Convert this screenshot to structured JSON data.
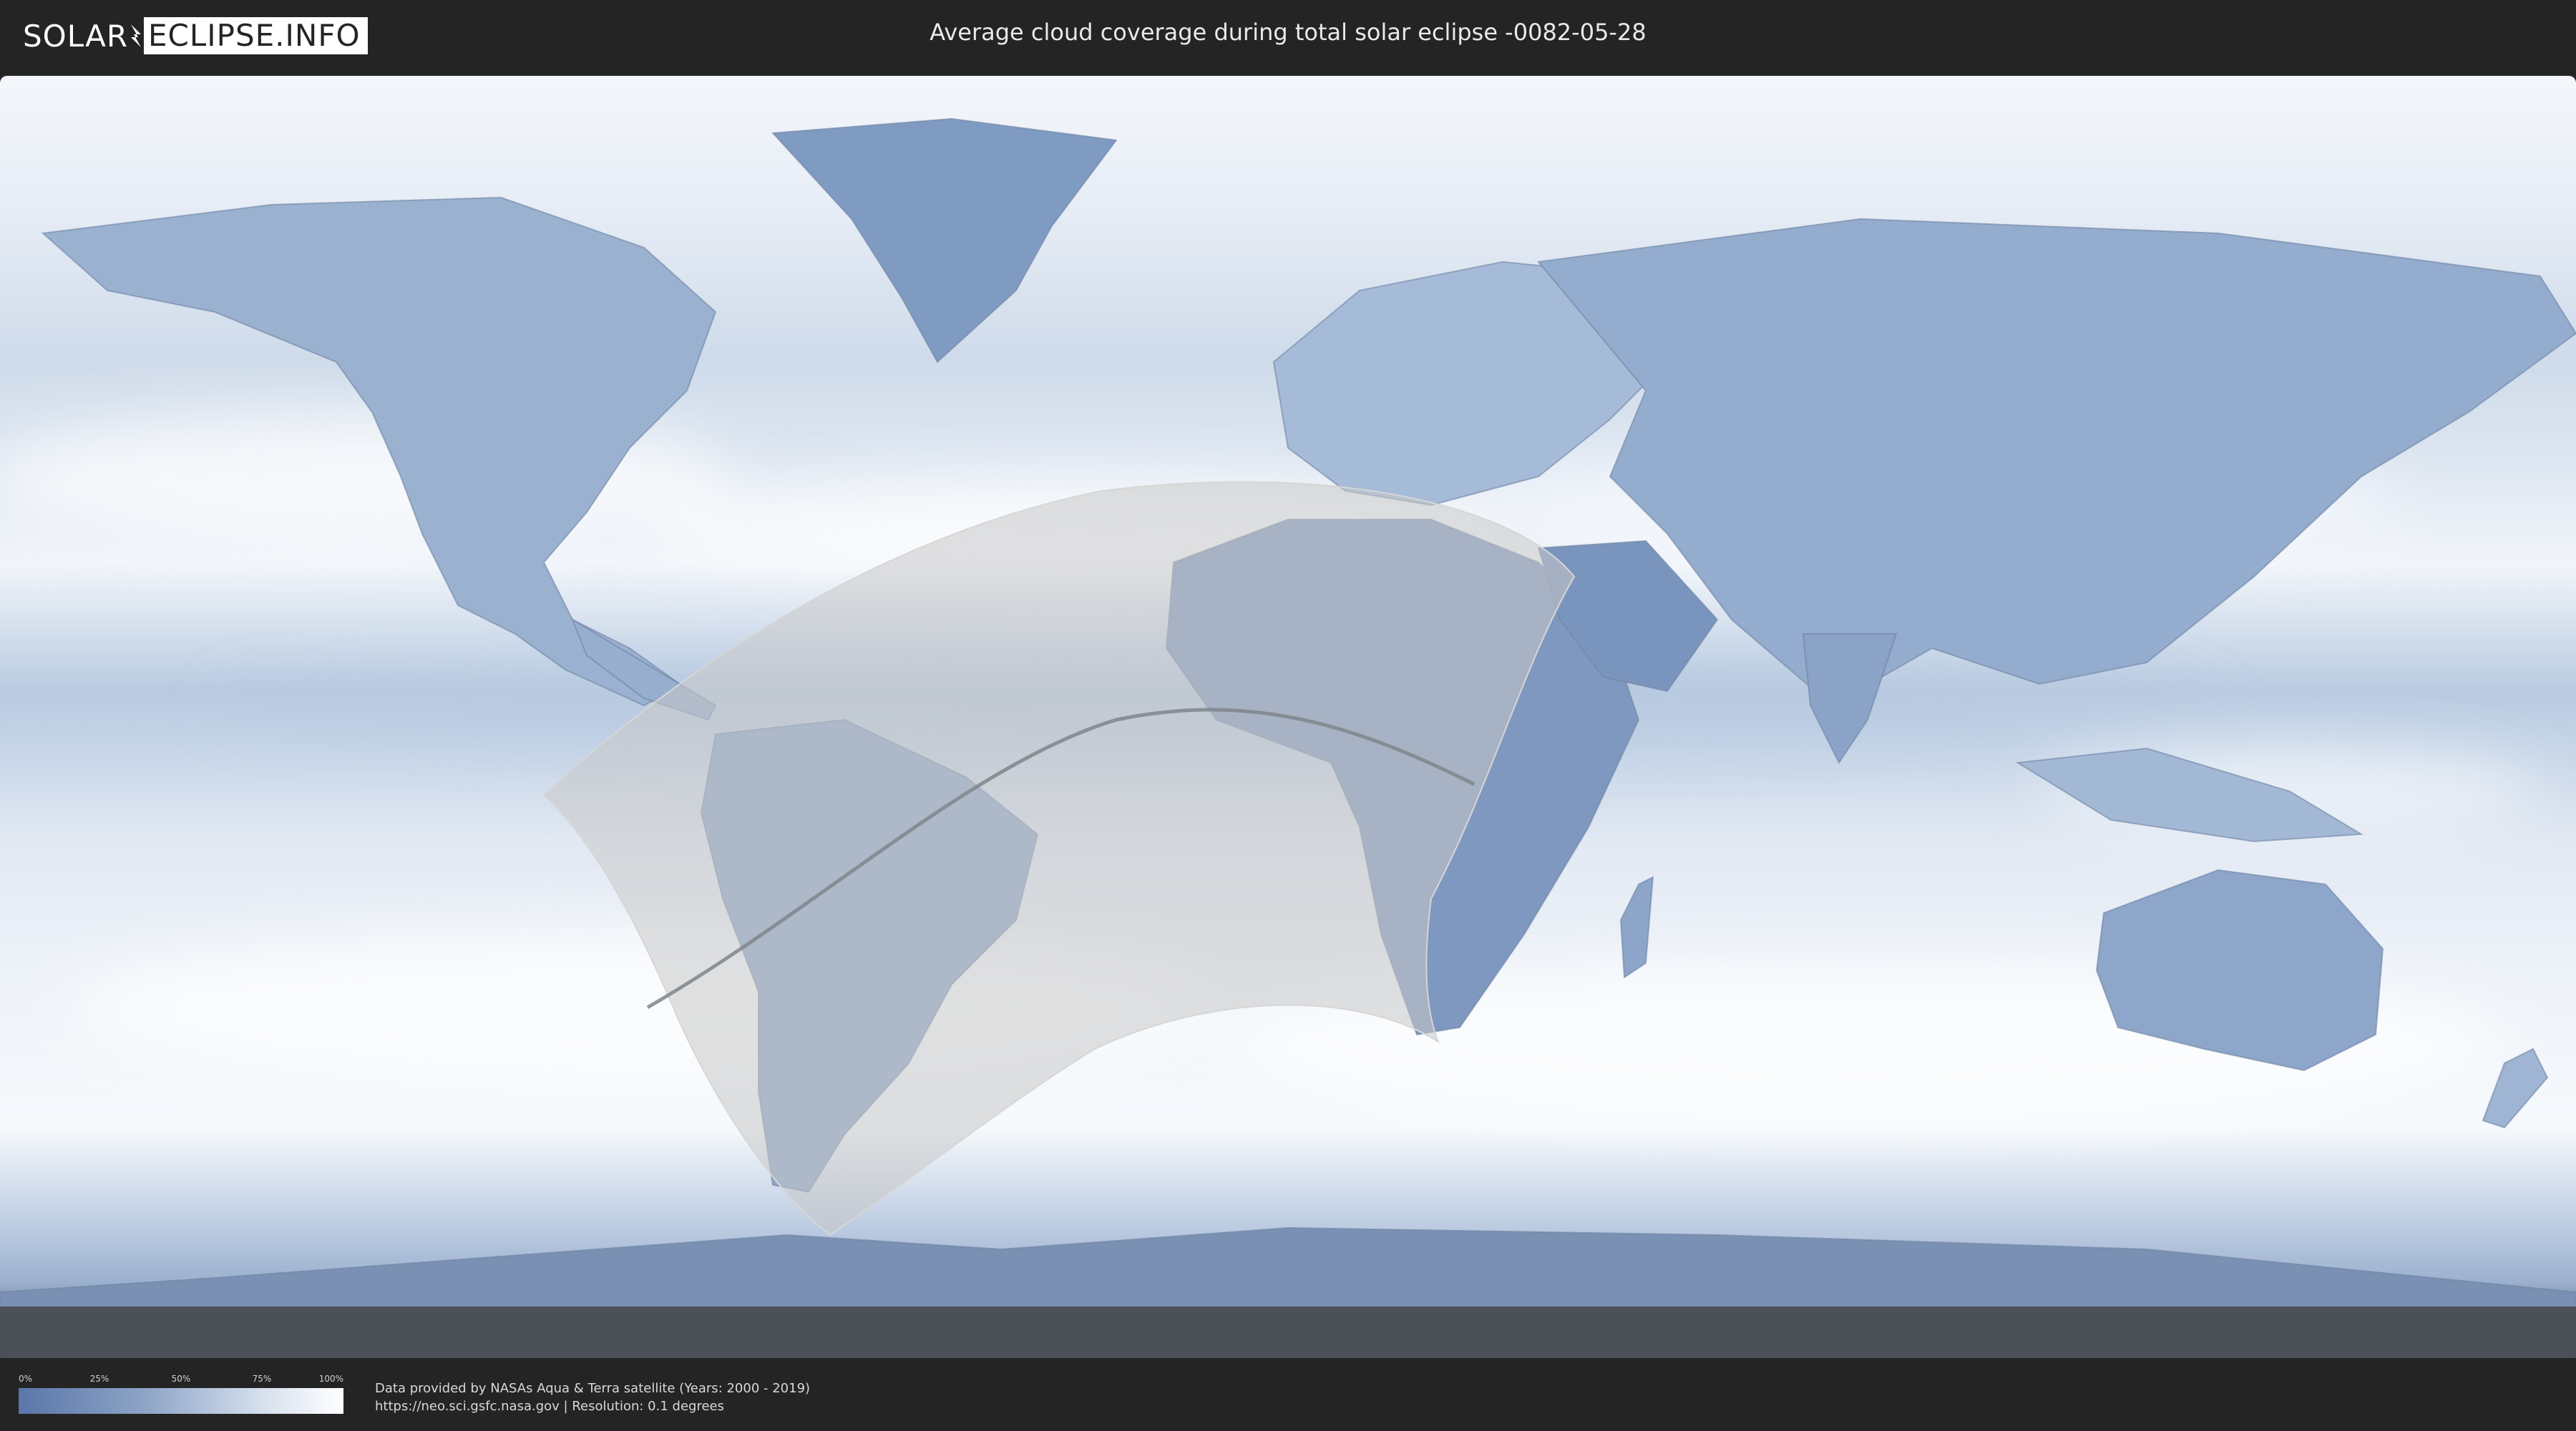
{
  "header": {
    "logo_solar": "SOLAR",
    "logo_eclipse": "ECLIPSE.INFO",
    "title": "Average cloud coverage during total solar eclipse -0082-05-28"
  },
  "legend": {
    "ticks": [
      "0%",
      "25%",
      "50%",
      "75%",
      "100%"
    ],
    "tick_values": [
      0,
      0.25,
      0.5,
      0.75,
      1.0
    ],
    "color_low": "#5a76a8",
    "color_high": "#ffffff"
  },
  "footer": {
    "credit_line1": "Data provided by NASAs Aqua & Terra satellite (Years: 2000 - 2019)",
    "credit_line2": "https://neo.sci.gsfc.nasa.gov | Resolution: 0.1 degrees"
  },
  "colors": {
    "background": "#242424",
    "ocean_clear": "#eef3f9",
    "land_cloudfree": "#8aa3c6",
    "eclipse_overlay": "#c8c8c8",
    "central_line": "#7f858c"
  }
}
